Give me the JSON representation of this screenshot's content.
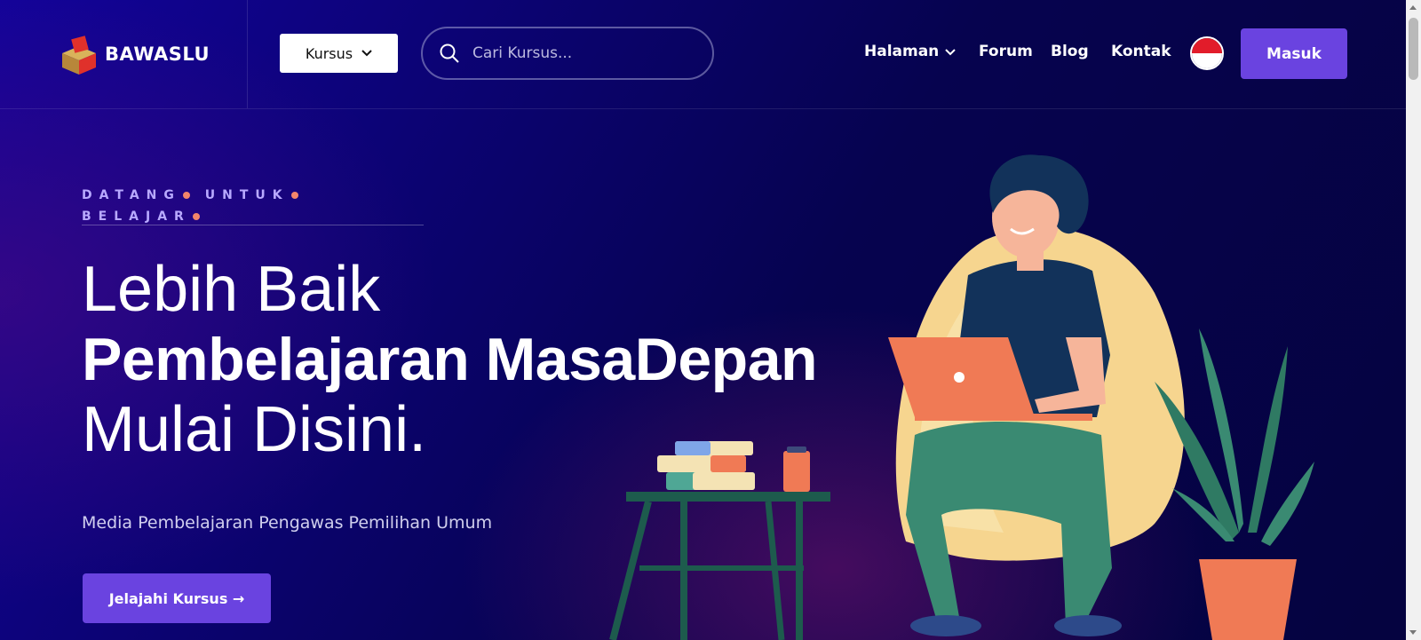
{
  "header": {
    "logo_text": "BAWASLU",
    "kursus_label": "Kursus",
    "search_placeholder": "Cari Kursus...",
    "nav": {
      "halaman": "Halaman",
      "forum": "Forum",
      "blog": "Blog",
      "kontak": "Kontak"
    },
    "masuk_label": "Masuk"
  },
  "hero": {
    "tagline_words": [
      "DATANG",
      "UNTUK",
      "BELAJAR"
    ],
    "heading_line1": "Lebih Baik",
    "heading_line2": "Pembelajaran MasaDepan",
    "heading_line3": "Mulai Disini.",
    "subtitle": "Media Pembelajaran Pengawas Pemilihan Umum",
    "cta_label": "Jelajahi Kursus →"
  },
  "colors": {
    "accent": "#6a43e0",
    "dot": "#f2856a",
    "background": "#06034f"
  },
  "icons": [
    "logo-box-icon",
    "chevron-down-icon",
    "search-icon",
    "indonesia-flag-icon",
    "arrow-right-icon"
  ]
}
